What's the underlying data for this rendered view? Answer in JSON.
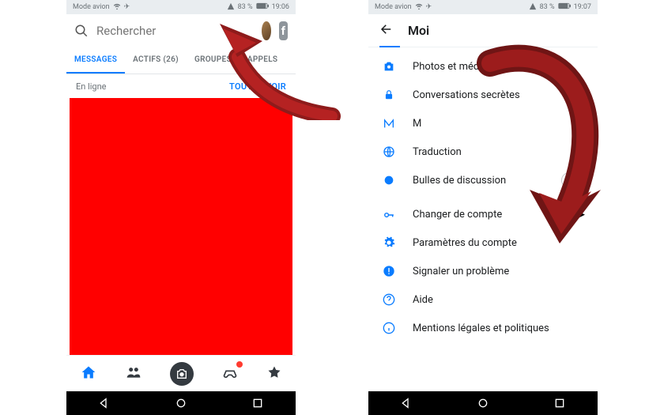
{
  "status": {
    "mode": "Mode avion",
    "signal": "83 %",
    "time_left": "19:06",
    "time_right": "19:07"
  },
  "left": {
    "search_placeholder": "Rechercher",
    "tabs": {
      "messages": "MESSAGES",
      "actifs": "ACTIFS (26)",
      "groupes": "GROUPES",
      "appels": "APPELS"
    },
    "subrow": {
      "online": "En ligne",
      "replay": "TOUT REVOIR"
    },
    "fb_label": "f"
  },
  "right": {
    "title": "Moi",
    "items": {
      "photos": "Photos et médias",
      "secret": "Conversations secrètes",
      "m": "M",
      "traduction": "Traduction",
      "bulles": "Bulles de discussion",
      "changer": "Changer de compte",
      "params": "Paramètres du compte",
      "signaler": "Signaler un problème",
      "aide": "Aide",
      "mentions": "Mentions légales et politiques"
    }
  }
}
